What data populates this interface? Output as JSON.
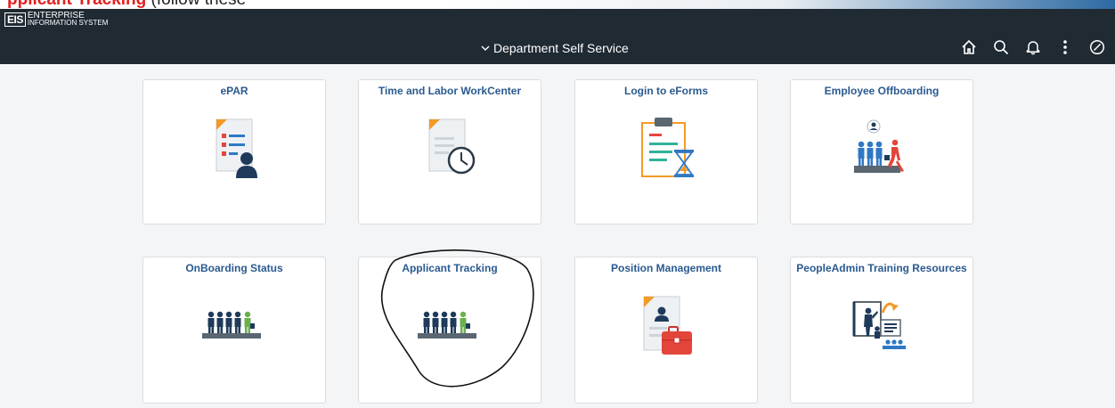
{
  "annotation_caption": {
    "bold_text": "pplicant Tracking",
    "paren_text": "(follow these"
  },
  "header": {
    "logo_abbrev": "EIS",
    "logo_line1": "ENTERPRISE",
    "logo_line2": "INFORMATION SYSTEM",
    "title": "Department Self Service",
    "background": "#1f2a33",
    "icons": [
      "home-icon",
      "search-icon",
      "bell-icon",
      "more-vertical-icon",
      "compass-icon"
    ]
  },
  "tiles": [
    {
      "label": "ePAR",
      "icon": "epar-form-icon"
    },
    {
      "label": "Time and Labor WorkCenter",
      "icon": "document-clock-icon"
    },
    {
      "label": "Login to eForms",
      "icon": "clipboard-hourglass-icon"
    },
    {
      "label": "Employee Offboarding",
      "icon": "offboarding-people-icon"
    },
    {
      "label": "OnBoarding Status",
      "icon": "onboarding-people-icon"
    },
    {
      "label": "Applicant Tracking",
      "icon": "applicant-people-icon"
    },
    {
      "label": "Position Management",
      "icon": "position-briefcase-icon"
    },
    {
      "label": "PeopleAdmin Training Resources",
      "icon": "training-presentation-icon"
    }
  ],
  "colors": {
    "tile_label": "#2a5a90",
    "accent_red": "#e4453a",
    "accent_orange": "#f39a27",
    "people_navy": "#1f3a5a",
    "people_green": "#6ab04c"
  }
}
